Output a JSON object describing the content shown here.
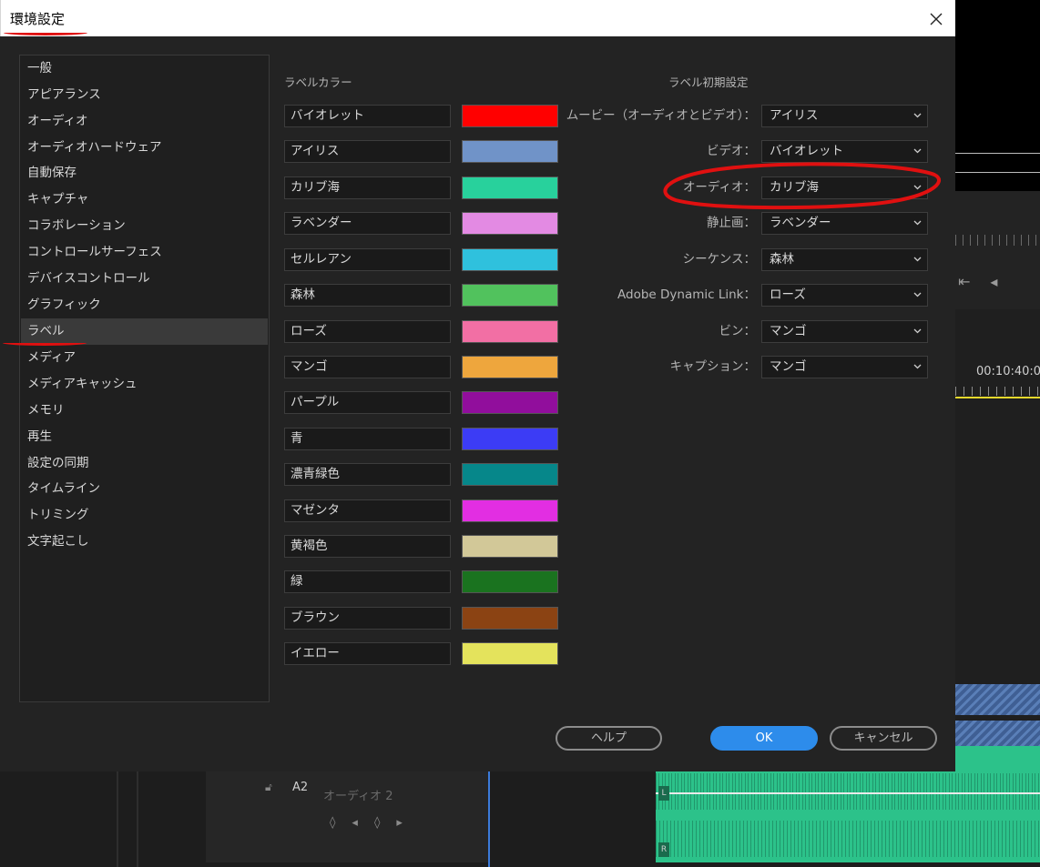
{
  "dialog": {
    "title": "環境設定",
    "close_label": "×"
  },
  "sidebar": {
    "items": [
      {
        "label": "一般"
      },
      {
        "label": "アピアランス"
      },
      {
        "label": "オーディオ"
      },
      {
        "label": "オーディオハードウェア"
      },
      {
        "label": "自動保存"
      },
      {
        "label": "キャプチャ"
      },
      {
        "label": "コラボレーション"
      },
      {
        "label": "コントロールサーフェス"
      },
      {
        "label": "デバイスコントロール"
      },
      {
        "label": "グラフィック"
      },
      {
        "label": "ラベル",
        "selected": true
      },
      {
        "label": "メディア"
      },
      {
        "label": "メディアキャッシュ"
      },
      {
        "label": "メモリ"
      },
      {
        "label": "再生"
      },
      {
        "label": "設定の同期"
      },
      {
        "label": "タイムライン"
      },
      {
        "label": "トリミング"
      },
      {
        "label": "文字起こし"
      }
    ]
  },
  "label_colors": {
    "heading": "ラベルカラー",
    "items": [
      {
        "name": "バイオレット",
        "color": "#ff0000"
      },
      {
        "name": "アイリス",
        "color": "#7093c8"
      },
      {
        "name": "カリブ海",
        "color": "#28d19c"
      },
      {
        "name": "ラベンダー",
        "color": "#e38ae3"
      },
      {
        "name": "セルレアン",
        "color": "#2fc1dd"
      },
      {
        "name": "森林",
        "color": "#51c25d"
      },
      {
        "name": "ローズ",
        "color": "#f26fa4"
      },
      {
        "name": "マンゴ",
        "color": "#eea63d"
      },
      {
        "name": "パープル",
        "color": "#910e9c"
      },
      {
        "name": "青",
        "color": "#3c3cf5"
      },
      {
        "name": "濃青緑色",
        "color": "#06878a"
      },
      {
        "name": "マゼンタ",
        "color": "#e22ee2"
      },
      {
        "name": "黄褐色",
        "color": "#d2c898"
      },
      {
        "name": "緑",
        "color": "#1a731f"
      },
      {
        "name": "ブラウン",
        "color": "#8b4313"
      },
      {
        "name": "イエロー",
        "color": "#e4e35c"
      }
    ]
  },
  "label_defaults": {
    "heading": "ラベル初期設定",
    "rows": [
      {
        "label": "ムービー（オーディオとビデオ）：",
        "value": "アイリス"
      },
      {
        "label": "ビデオ：",
        "value": "バイオレット"
      },
      {
        "label": "オーディオ：",
        "value": "カリブ海"
      },
      {
        "label": "静止画：",
        "value": "ラベンダー"
      },
      {
        "label": "シーケンス：",
        "value": "森林"
      },
      {
        "label": "Adobe Dynamic Link：",
        "value": "ローズ"
      },
      {
        "label": "ビン：",
        "value": "マンゴ"
      },
      {
        "label": "キャプション：",
        "value": "マンゴ"
      }
    ]
  },
  "buttons": {
    "help": "ヘルプ",
    "ok": "OK",
    "cancel": "キャンセル"
  },
  "background_app": {
    "timecode": "00:10:40:0",
    "track_id": "A2",
    "track_name": "オーディオ 2",
    "channel_left": "L",
    "channel_right": "R"
  }
}
